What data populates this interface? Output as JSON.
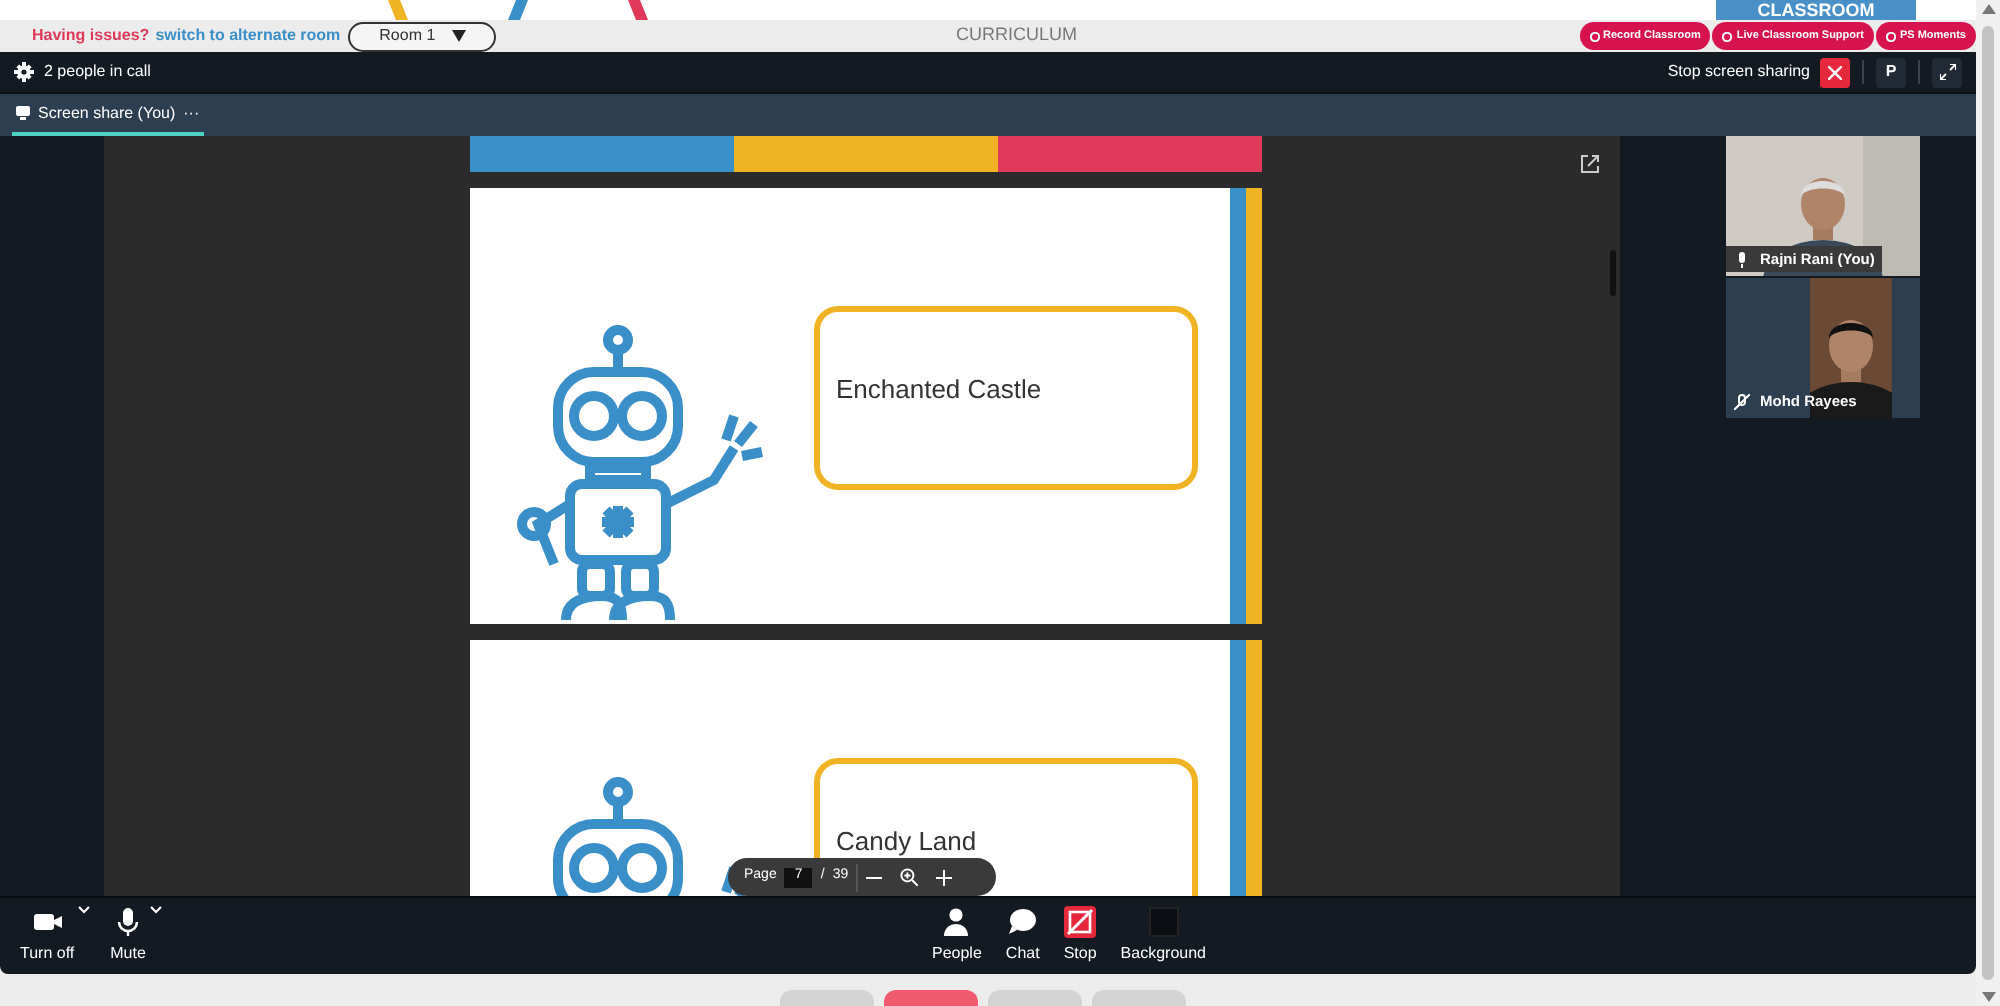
{
  "top_bar": {
    "issue_text": "Having issues?",
    "switch_link": "switch to alternate room",
    "room_select": "Room 1",
    "title": "CURRICULUM",
    "classroom_tab": "CLASSROOM",
    "action_buttons": [
      "Record Classroom",
      "Live Classroom Support",
      "PS Moments"
    ]
  },
  "call_header": {
    "people_count": "2 people in call",
    "stop_sharing": "Stop screen sharing",
    "avatar_letter": "P"
  },
  "tabs": [
    {
      "label": "Screen share (You)",
      "selected": true,
      "menu_glyph": "···"
    }
  ],
  "slides": [
    {
      "caption": "Enchanted Castle"
    },
    {
      "caption": "Candy Land"
    }
  ],
  "pager": {
    "label": "Page",
    "value": "7",
    "separator": "/",
    "total": "39"
  },
  "participants": [
    {
      "name": "Rajni Rani (You)",
      "muted": false
    },
    {
      "name": "Mohd Rayees",
      "muted": true
    }
  ],
  "controls_left": [
    {
      "label": "Turn off",
      "kind": "camera"
    },
    {
      "label": "Mute",
      "kind": "mic"
    }
  ],
  "controls_center": [
    {
      "label": "People",
      "kind": "people"
    },
    {
      "label": "Chat",
      "kind": "chat"
    },
    {
      "label": "Stop",
      "kind": "stop"
    },
    {
      "label": "Background",
      "kind": "background"
    }
  ],
  "bottom_tabs": [
    {
      "selected": false
    },
    {
      "selected": true
    },
    {
      "selected": false
    },
    {
      "selected": false
    }
  ]
}
